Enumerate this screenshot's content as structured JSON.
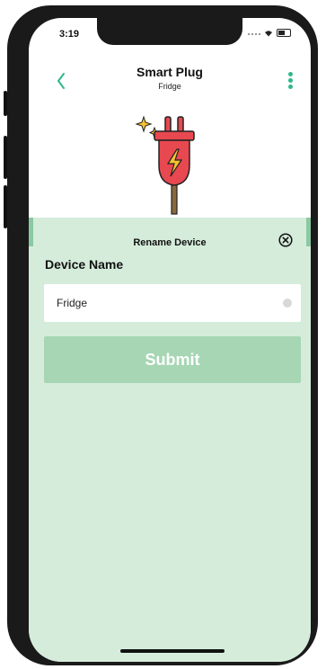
{
  "status_bar": {
    "time": "3:19"
  },
  "header": {
    "title": "Smart Plug",
    "subtitle": "Fridge"
  },
  "rename_sheet": {
    "title": "Rename Device",
    "field_label": "Device Name",
    "input_value": "Fridge",
    "submit_label": "Submit"
  },
  "colors": {
    "accent": "#2fb88a",
    "sheet_background": "#d5ecdb",
    "submit_background": "#a6d6b3",
    "plug_red": "#e8484f",
    "bolt_yellow": "#f6c230"
  },
  "icons": {
    "back": "chevron-left-icon",
    "menu": "more-vertical-icon",
    "device": "power-plug-icon",
    "close": "close-circle-icon",
    "clear": "clear-input-icon"
  }
}
